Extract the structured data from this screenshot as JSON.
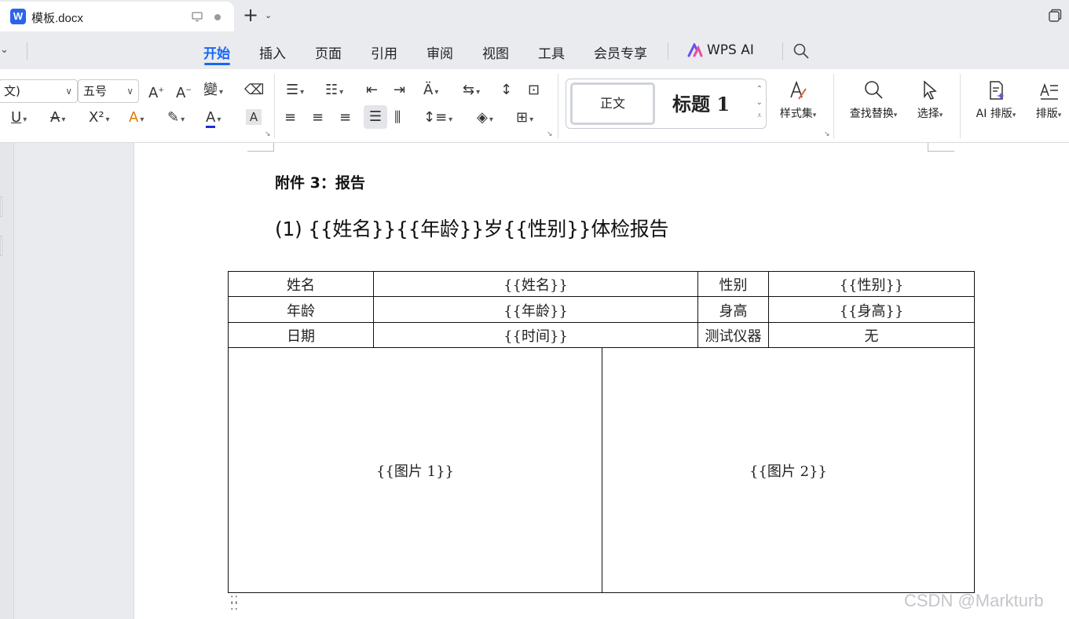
{
  "tab": {
    "title": "模板.docx"
  },
  "menu": {
    "items": [
      "开始",
      "插入",
      "页面",
      "引用",
      "审阅",
      "视图",
      "工具",
      "会员专享"
    ],
    "ai_label": "WPS AI"
  },
  "ribbon": {
    "font_name": "文)",
    "font_size": "五号",
    "styles": {
      "normal": "正文",
      "heading1": "标题 1"
    },
    "buttons": {
      "style_set": "样式集",
      "find_replace": "查找替换",
      "select": "选择",
      "ai_layout": "AI 排版",
      "layout": "排版"
    }
  },
  "document": {
    "heading": "附件 3：报告",
    "title": "(1) {{姓名}}{{年龄}}岁{{性别}}体检报告",
    "table": {
      "rows": [
        [
          "姓名",
          "{{姓名}}",
          "性别",
          "{{性别}}"
        ],
        [
          "年龄",
          "{{年龄}}",
          "身高",
          "{{身高}}"
        ],
        [
          "日期",
          "{{时间}}",
          "测试仪器",
          "无"
        ]
      ],
      "images": [
        "{{图片 1}}",
        "{{图片 2}}"
      ]
    }
  },
  "watermark": "CSDN @Markturb",
  "colors": {
    "accent": "#1a66f2",
    "brand": "#2b64e8"
  }
}
